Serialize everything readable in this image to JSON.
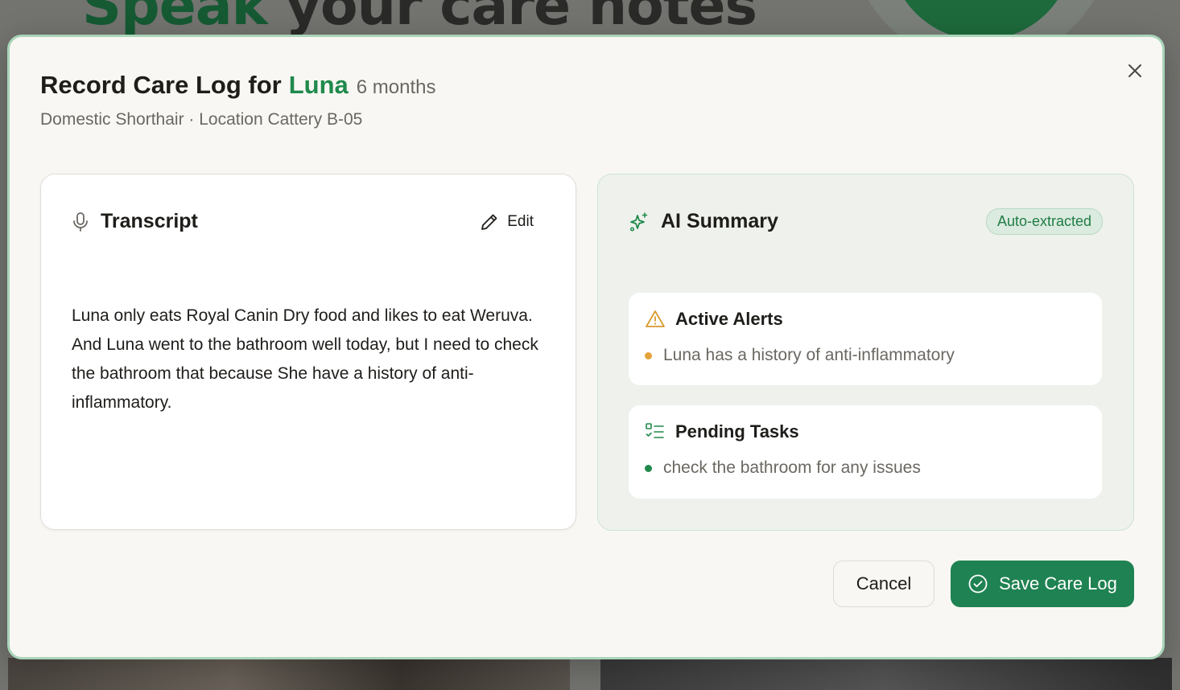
{
  "background": {
    "headline_part1": "Speak",
    "headline_part2": "your care notes"
  },
  "modal": {
    "title": "Record Care Log for",
    "pet_name": "Luna",
    "pet_age": "6 months",
    "subtitle": "Domestic Shorthair · Location Cattery B-05",
    "close_icon": "close-icon"
  },
  "transcript": {
    "title": "Transcript",
    "icon": "microphone-icon",
    "edit_label": "Edit",
    "edit_icon": "pencil-icon",
    "text": "Luna only eats Royal Canin Dry food and likes to eat Weruva. And Luna went to the bathroom well today, but I need to check the bathroom that because She have a history of anti-inflammatory."
  },
  "summary": {
    "title": "AI Summary",
    "icon": "sparkles-icon",
    "badge": "Auto-extracted",
    "alerts": {
      "title": "Active Alerts",
      "icon": "warning-icon",
      "items": [
        "Luna has a history of anti-inflammatory"
      ]
    },
    "tasks": {
      "title": "Pending Tasks",
      "icon": "checklist-icon",
      "items": [
        "check the bathroom for any issues"
      ]
    }
  },
  "footer": {
    "cancel_label": "Cancel",
    "save_label": "Save Care Log",
    "save_icon": "check-circle-icon"
  },
  "colors": {
    "accent": "#1f8a4c",
    "save_button": "#1f8252",
    "alert_dot": "#e3a33a",
    "task_dot": "#1f8a4c",
    "modal_bg": "#f8f7f3",
    "summary_bg": "#eef1ec"
  }
}
